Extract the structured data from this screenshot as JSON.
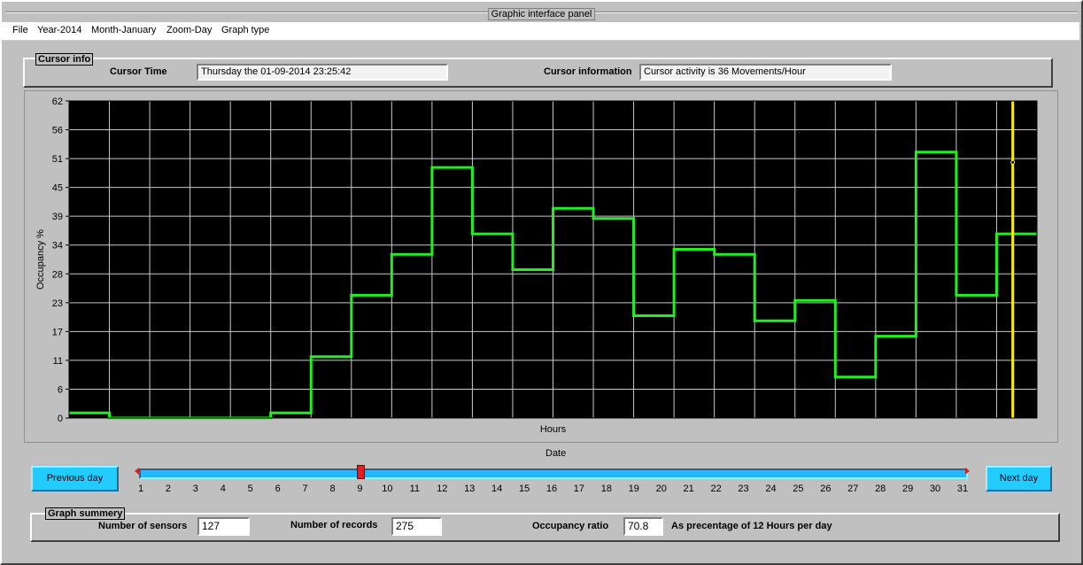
{
  "window": {
    "title": "Graphic interface panel"
  },
  "menu": [
    "File",
    "Year-2014",
    "Month-January",
    "Zoom-Day",
    "Graph type"
  ],
  "cursor_panel": {
    "label": "Cursor info",
    "time_label": "Cursor Time",
    "time_value": "Thursday the 01-09-2014 23:25:42",
    "info_label": "Cursor information",
    "info_value": "Cursor activity is 36 Movements/Hour"
  },
  "chart_data": {
    "type": "line",
    "step": true,
    "xlabel": "Hours",
    "ylabel": "Occupancy %",
    "yticks": [
      0,
      6,
      11,
      17,
      23,
      28,
      34,
      39,
      45,
      51,
      56,
      62
    ],
    "ylim": [
      0,
      62
    ],
    "xlim": [
      0,
      24
    ],
    "grid": true,
    "background": "#000000",
    "grid_color": "#c8c8c8",
    "line_color": "#22ee22",
    "cursor_color": "#ffee00",
    "cursor_x": 23.4,
    "cursor_y": 50,
    "series": [
      {
        "values": [
          1,
          0,
          0,
          0,
          0,
          1,
          12,
          24,
          32,
          49,
          36,
          29,
          41,
          39,
          20,
          33,
          32,
          19,
          23,
          8,
          16,
          52,
          24,
          36
        ]
      }
    ]
  },
  "slider": {
    "label": "Date",
    "ticks": [
      "1",
      "2",
      "3",
      "4",
      "5",
      "6",
      "7",
      "8",
      "9",
      "10",
      "11",
      "12",
      "13",
      "14",
      "15",
      "16",
      "17",
      "18",
      "19",
      "20",
      "21",
      "22",
      "23",
      "24",
      "25",
      "26",
      "27",
      "28",
      "29",
      "30",
      "31"
    ],
    "min": 1,
    "max": 31,
    "value": 9
  },
  "buttons": {
    "prev": "Previous day",
    "next": "Next  day"
  },
  "summary": {
    "label": "Graph summery",
    "sensors_label": "Number of sensors",
    "sensors_value": "127",
    "records_label": "Number of records",
    "records_value": "275",
    "ratio_label": "Occupancy ratio",
    "ratio_value": "70.8",
    "ratio_note": "As precentage of 12 Hours per day"
  },
  "colors": {
    "button": "#22ccff",
    "slider": "#22b8ff",
    "thumb": "#e02020"
  }
}
